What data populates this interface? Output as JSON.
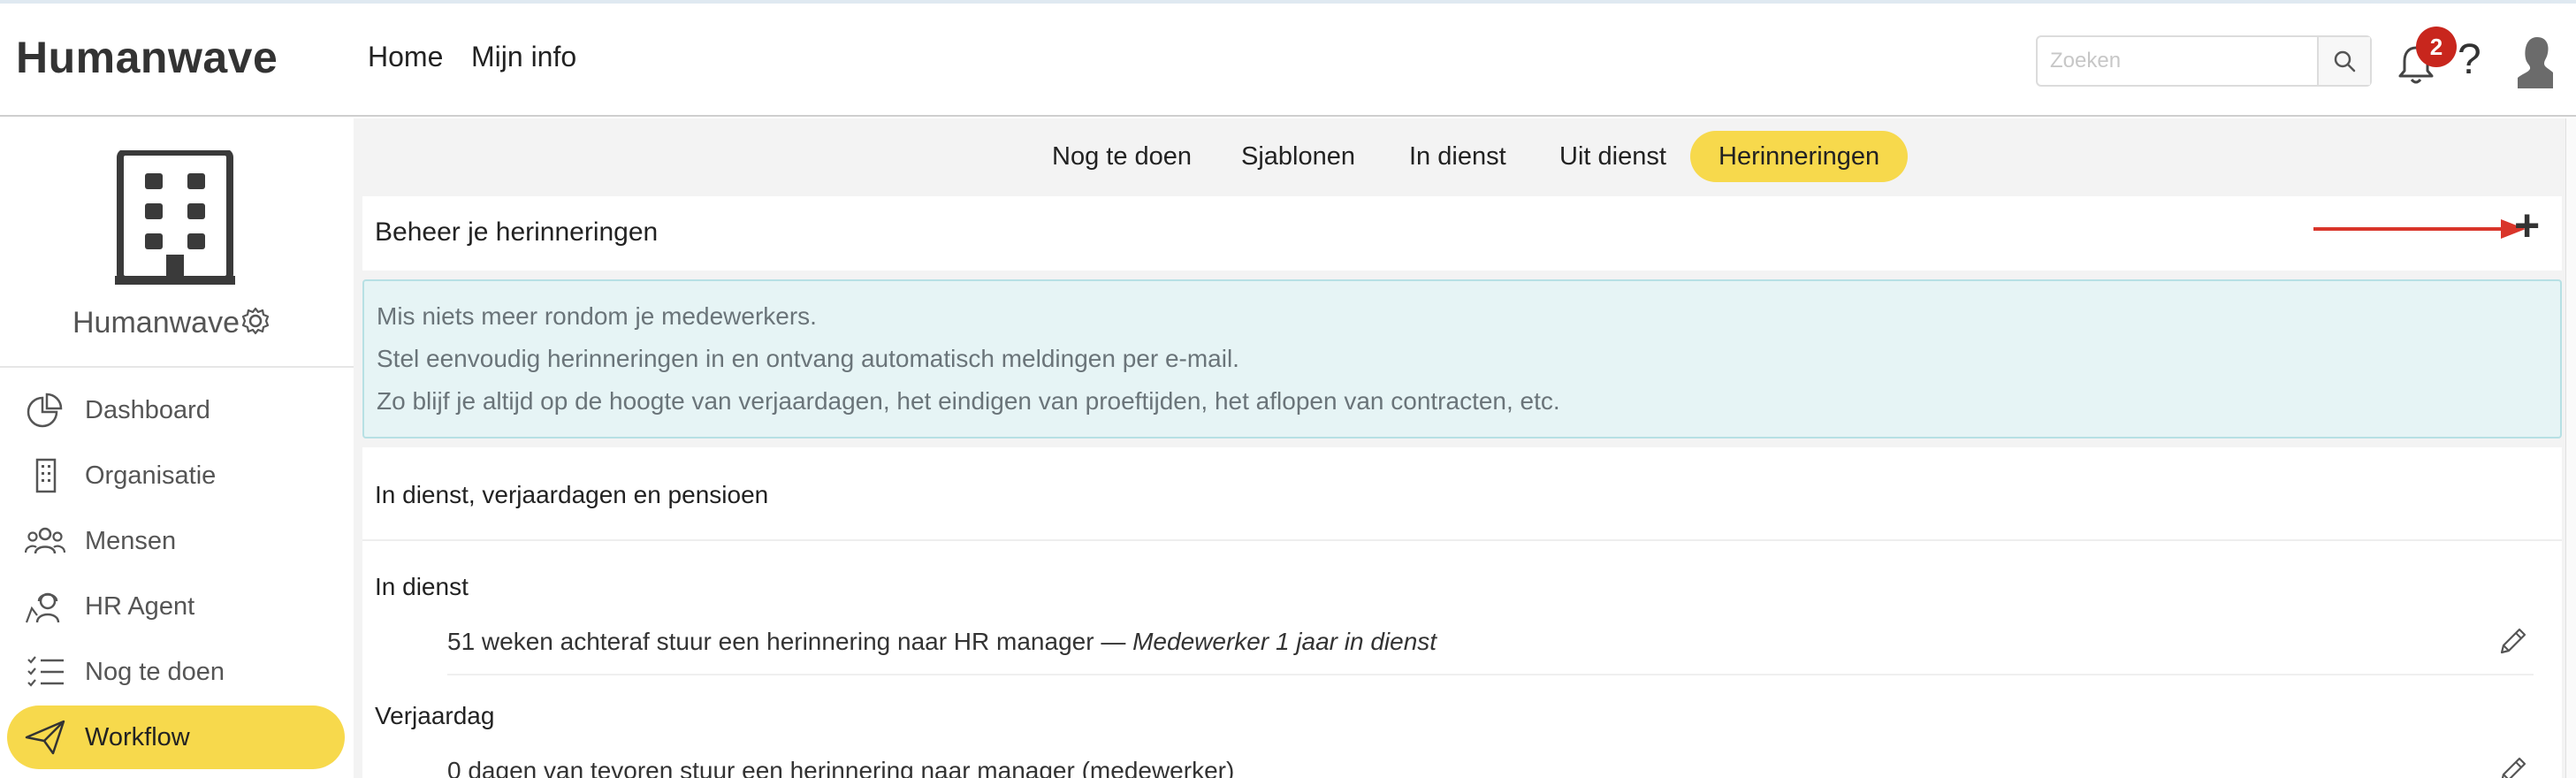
{
  "app": {
    "logo": "Humanwave"
  },
  "header": {
    "nav": [
      {
        "label": "Home"
      },
      {
        "label": "Mijn info"
      }
    ],
    "search": {
      "placeholder": "Zoeken",
      "value": ""
    },
    "notifications": {
      "count": "2",
      "icon": "bell-icon"
    },
    "help": {
      "label": "?"
    },
    "avatar": {
      "icon": "user-silhouette-icon"
    }
  },
  "sidebar": {
    "company_name": "Humanwave",
    "items": [
      {
        "label": "Dashboard",
        "icon": "pie-chart-icon"
      },
      {
        "label": "Organisatie",
        "icon": "building-icon"
      },
      {
        "label": "Mensen",
        "icon": "people-icon"
      },
      {
        "label": "HR Agent",
        "icon": "agent-icon"
      },
      {
        "label": "Nog te doen",
        "icon": "checklist-icon"
      },
      {
        "label": "Workflow",
        "icon": "paper-plane-icon",
        "active": true
      }
    ]
  },
  "tabs": [
    {
      "label": "Nog te doen"
    },
    {
      "label": "Sjablonen"
    },
    {
      "label": "In dienst"
    },
    {
      "label": "Uit dienst"
    },
    {
      "label": "Herinneringen",
      "active": true
    }
  ],
  "reminders": {
    "title": "Beheer je herinneringen",
    "add_label": "+",
    "info_lines": [
      "Mis niets meer rondom je medewerkers.",
      "Stel eenvoudig herinneringen in en ontvang automatisch meldingen per e-mail.",
      "Zo blijf je altijd op de hoogte van verjaardagen, het eindigen van proeftijden, het aflopen van contracten, etc."
    ],
    "section_title": "In dienst, verjaardagen en pensioen",
    "groups": [
      {
        "label": "In dienst",
        "rows": [
          {
            "text": "51 weken achteraf stuur een herinnering naar HR manager — ",
            "italic": "Medewerker 1 jaar in dienst"
          }
        ]
      },
      {
        "label": "Verjaardag",
        "rows": [
          {
            "text": "0 dagen van tevoren stuur een herinnering naar manager (medewerker)",
            "italic": ""
          }
        ]
      }
    ]
  },
  "colors": {
    "accent": "#f7d94c",
    "badge": "#c8261d",
    "info_bg": "#e6f4f5",
    "arrow": "#d9352a"
  }
}
